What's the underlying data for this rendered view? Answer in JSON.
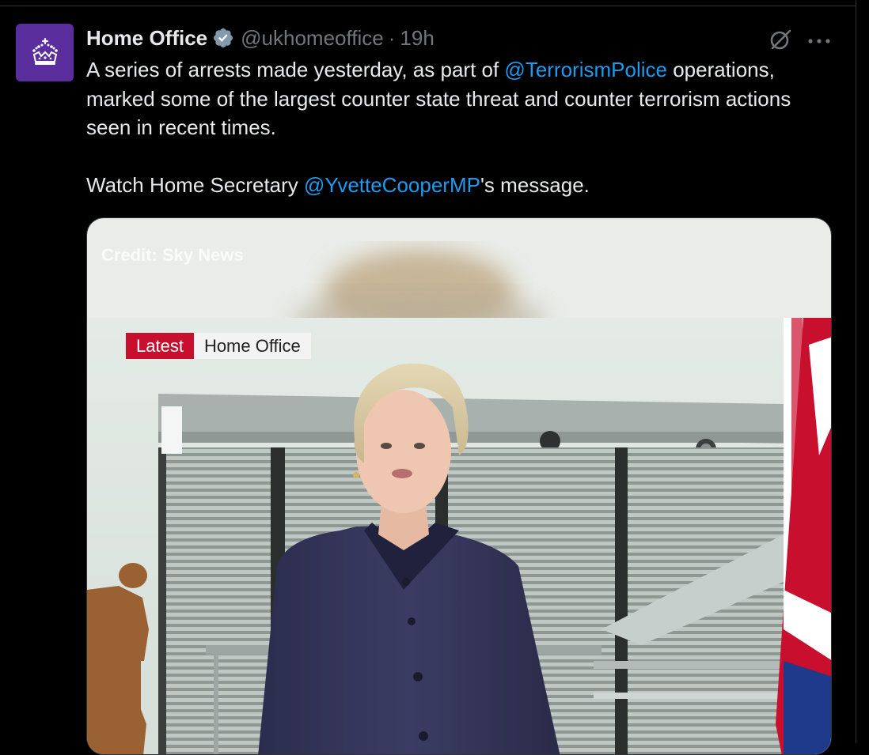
{
  "tweet": {
    "display_name": "Home Office",
    "handle": "@ukhomeoffice",
    "separator": "·",
    "time": "19h",
    "text": {
      "line1_prefix": "A series of arrests made yesterday, as part of ",
      "mention1": "@TerrorismPolice",
      "line1_suffix": " operations, marked some of the largest counter state threat and counter terrorism actions seen in recent times.",
      "line2_prefix": "Watch Home Secretary ",
      "mention2": "@YvetteCooperMP",
      "line2_suffix": "'s message."
    }
  },
  "media": {
    "credit": "Credit: Sky News",
    "tag_latest": "Latest",
    "tag_source": "Home Office"
  },
  "icons": {
    "avatar": "crown-logo-icon",
    "verified": "verified-badge-icon",
    "grok": "grok-icon",
    "more": "more-icon"
  },
  "colors": {
    "background": "#000000",
    "text": "#e7e9ea",
    "muted": "#71767b",
    "link": "#1d9bf0",
    "avatar_bg": "#5b2e9e",
    "news_red": "#c8102e"
  }
}
